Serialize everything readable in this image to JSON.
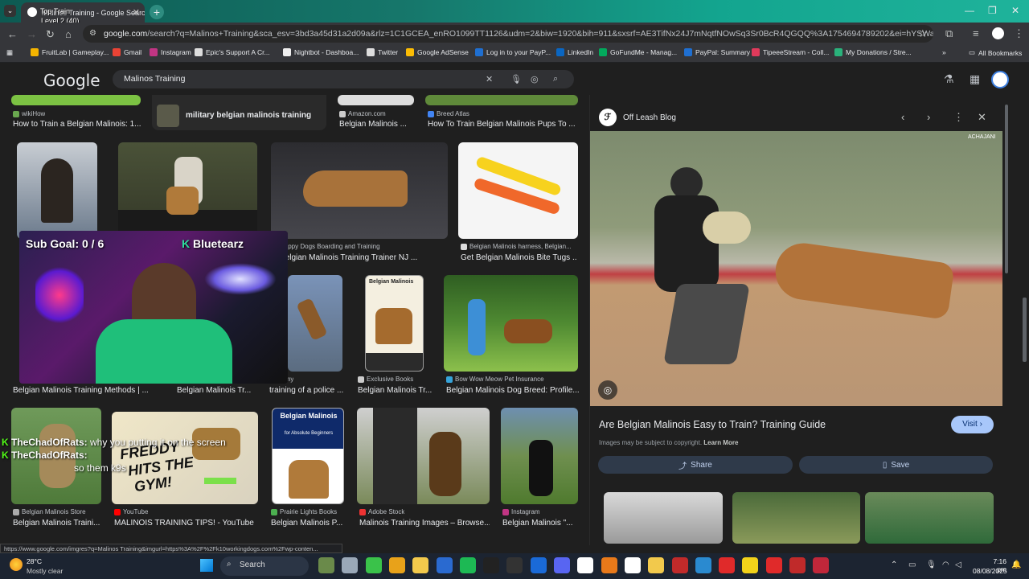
{
  "browser": {
    "tab_title": "Malinos Training - Google Search",
    "tab_overlay": "Top Train",
    "level_text": "Level 2  (40)",
    "url_host": "google.com",
    "url_rest": "/search?q=Malinos+Training&sca_esv=3bd3a45d31a2d09a&rlz=1C1GCEA_enRO1099TT1126&udm=2&biw=1920&bih=911&sxsrf=AE3TifNx24J7mNqtfNOwSq3Sr0BcR4QGQQ%3A1754694789202&ei=hYSWaM2GDI-v5NoP2deIWA...",
    "bookmarks": [
      {
        "label": "FruitLab | Gameplay...",
        "color": "#f4b400"
      },
      {
        "label": "Gmail",
        "color": "#ea4335"
      },
      {
        "label": "Instagram",
        "color": "#c13584"
      },
      {
        "label": "Epic's Support A Cr...",
        "color": "#dddddd"
      },
      {
        "label": "Nightbot - Dashboa...",
        "color": "#eeeeee"
      },
      {
        "label": "Twitter",
        "color": "#dddddd"
      },
      {
        "label": "Google AdSense",
        "color": "#fbbc04"
      },
      {
        "label": "Log in to your PayP...",
        "color": "#1f6fd1"
      },
      {
        "label": "LinkedIn",
        "color": "#0a66c2"
      },
      {
        "label": "GoFundMe - Manag...",
        "color": "#02a95c"
      },
      {
        "label": "PayPal: Summary",
        "color": "#1f6fd1"
      },
      {
        "label": "TipeeeStream - Coll...",
        "color": "#e03a5b"
      },
      {
        "label": "My Donations / Stre...",
        "color": "#2ab27b"
      }
    ],
    "all_bookmarks": "All Bookmarks",
    "status_url": "https://www.google.com/imgres?q=Malinos Training&imgurl=https%3A%2F%2Fk10workingdogs.com%2Fwp-conten..."
  },
  "google": {
    "logo": "Google",
    "query": "Malinos Training"
  },
  "results": {
    "row0": [
      {
        "source": "wikiHow",
        "title": "How to Train a Belgian Malinois: 1..."
      },
      {
        "related": "military belgian malinois training"
      },
      {
        "source": "Amazon.com",
        "title": "Belgian Malinois ..."
      },
      {
        "source": "Breed Atlas",
        "title": "How To Train Belgian Malinois Pups To ..."
      }
    ],
    "row1": [
      {
        "source": "Happy Dogs Boarding and Training",
        "title": "Belgian Malinois Training Trainer NJ ..."
      },
      {
        "source": "Belgian Malinois harness, Belgian...",
        "title": "Get Belgian Malinois Bite Tugs ..."
      }
    ],
    "row2": [
      {
        "source": "",
        "title": "Belgian Malinois Training Methods | ..."
      },
      {
        "source": "",
        "title": "Belgian Malinois Tr..."
      },
      {
        "source": "...my",
        "title": "training of a police ..."
      },
      {
        "source": "Exclusive Books",
        "title": "Belgian Malinois Tr..."
      },
      {
        "source": "Bow Wow Meow Pet Insurance",
        "title": "Belgian Malinois Dog Breed: Profile..."
      }
    ],
    "row3": [
      {
        "source": "Belgian Malinois Store",
        "title": "Belgian Malinois Traini..."
      },
      {
        "source": "YouTube",
        "title": "MALINOIS TRAINING TIPS! - YouTube"
      },
      {
        "source": "Prairie Lights Books",
        "title": "Belgian Malinois P..."
      },
      {
        "source": "Adobe Stock",
        "title": "Malinois Training Images – Browse..."
      },
      {
        "source": "Instagram",
        "title": "Belgian Malinois \"..."
      }
    ],
    "book_title": "Belgian Malinois",
    "book_sub": "Belgian Malinois",
    "book2_title": "Belgian Malinois",
    "book2_sub": "for Absolute Beginners",
    "yt_text1": "FREDDY",
    "yt_text2": "HITS THE",
    "yt_text3": "GYM!"
  },
  "panel": {
    "site": "Off Leash Blog",
    "watermark": "ACHAJANI",
    "title": "Are Belgian Malinois Easy to Train? Training Guide",
    "visit": "Visit",
    "copyright": "Images may be subject to copyright.",
    "learn_more": "Learn More",
    "share": "Share",
    "save": "Save"
  },
  "stream": {
    "sub_goal": "Sub Goal: 0 / 6",
    "brand": "Bluetearz",
    "chat": [
      {
        "user": "TheChadOfRats:",
        "msg": "why you putting it on the screen"
      },
      {
        "user": "TheChadOfRats:",
        "msg": "so them k9s"
      }
    ]
  },
  "taskbar": {
    "temp": "28°C",
    "weather": "Mostly clear",
    "search": "Search",
    "time": "7:16 pm",
    "date": "08/08/2025",
    "badge": "20"
  }
}
